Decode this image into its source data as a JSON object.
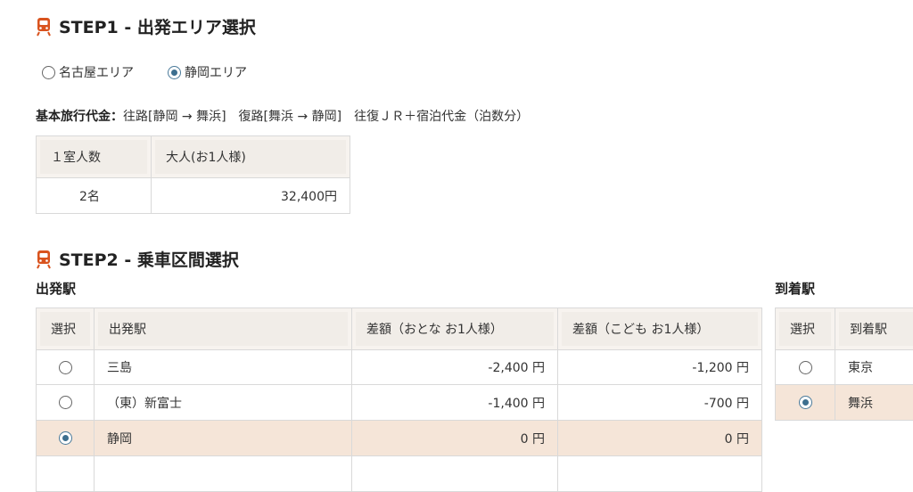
{
  "step1": {
    "heading": "STEP1 - 出発エリア選択",
    "areas": [
      {
        "label": "名古屋エリア",
        "checked": false
      },
      {
        "label": "静岡エリア",
        "checked": true
      }
    ],
    "price_label": "基本旅行代金：",
    "price_desc": "往路[静岡 → 舞浜]　復路[舞浜 → 静岡]　往復ＪＲ＋宿泊代金（泊数分）",
    "table": {
      "headers": [
        "１室人数",
        "大人(お1人様)"
      ],
      "rows": [
        [
          "2名",
          "32,400円"
        ]
      ]
    }
  },
  "step2": {
    "heading": "STEP2 - 乗車区間選択",
    "departure": {
      "title": "出発駅",
      "headers": [
        "選択",
        "出発駅",
        "差額（おとな お1人様）",
        "差額（こども お1人様）"
      ],
      "rows": [
        {
          "station": "三島",
          "adult": "-2,400 円",
          "child": "-1,200 円",
          "checked": false
        },
        {
          "station": "（東）新富士",
          "adult": "-1,400 円",
          "child": "-700 円",
          "checked": false
        },
        {
          "station": "静岡",
          "adult": "0 円",
          "child": "0 円",
          "checked": true
        }
      ]
    },
    "arrival": {
      "title": "到着駅",
      "headers": [
        "選択",
        "到着駅"
      ],
      "rows": [
        {
          "station": "東京",
          "checked": false
        },
        {
          "station": "舞浜",
          "checked": true
        }
      ]
    }
  },
  "colors": {
    "accent": "#d9531e",
    "selected_row": "#f5e5d8",
    "header_bg": "#f1ede8"
  }
}
